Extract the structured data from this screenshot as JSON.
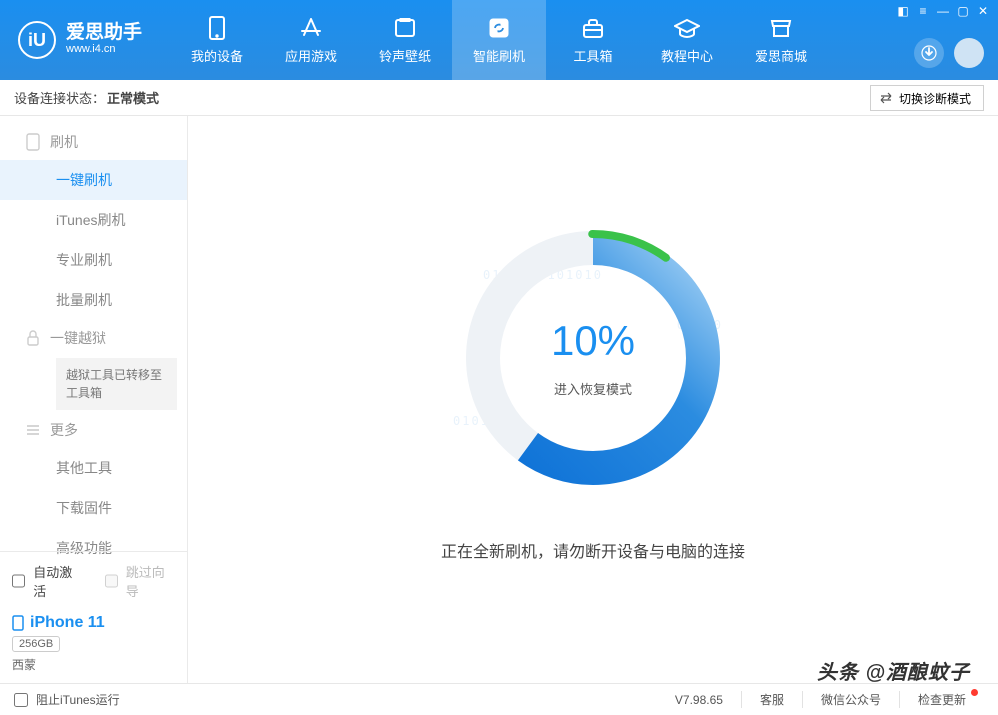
{
  "logo": {
    "title": "爱思助手",
    "sub": "www.i4.cn",
    "badge": "iU"
  },
  "nav": [
    {
      "id": "device",
      "label": "我的设备"
    },
    {
      "id": "apps",
      "label": "应用游戏"
    },
    {
      "id": "media",
      "label": "铃声壁纸"
    },
    {
      "id": "flash",
      "label": "智能刷机",
      "active": true
    },
    {
      "id": "toolbox",
      "label": "工具箱"
    },
    {
      "id": "tutorial",
      "label": "教程中心"
    },
    {
      "id": "store",
      "label": "爱思商城"
    }
  ],
  "subbar": {
    "label": "设备连接状态：",
    "value": "正常模式",
    "switch_btn": "切换诊断模式"
  },
  "sidebar": {
    "sec1_head": "刷机",
    "sec1_items": [
      "一键刷机",
      "iTunes刷机",
      "专业刷机",
      "批量刷机"
    ],
    "sec2_head": "一键越狱",
    "sec2_note": "越狱工具已转移至工具箱",
    "sec3_head": "更多",
    "sec3_items": [
      "其他工具",
      "下载固件",
      "高级功能"
    ],
    "chk_auto": "自动激活",
    "chk_skip": "跳过向导",
    "device": {
      "name": "iPhone 11",
      "storage": "256GB",
      "user": "西蒙"
    }
  },
  "progress": {
    "percent": 10,
    "display": "10%",
    "sub": "进入恢复模式",
    "hint": "正在全新刷机，请勿断开设备与电脑的连接"
  },
  "footer": {
    "block_itunes": "阻止iTunes运行",
    "version": "V7.98.65",
    "links": [
      "客服",
      "微信公众号",
      "检查更新"
    ]
  },
  "watermark": "头条 @酒酿蚊子"
}
